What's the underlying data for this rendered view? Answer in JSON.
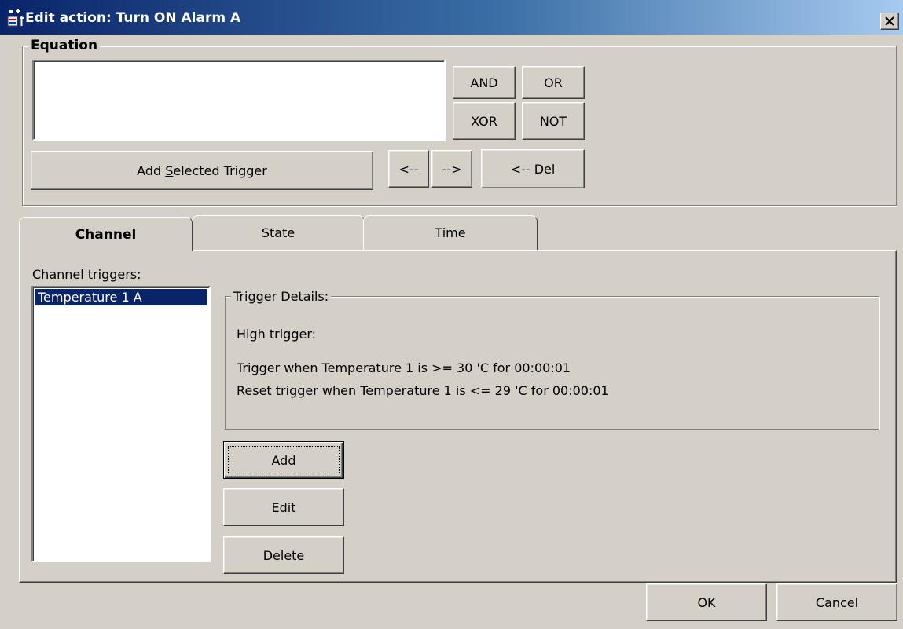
{
  "window": {
    "title": "Edit action: Turn ON Alarm A",
    "icon": "app-icon",
    "close_glyph": "✕"
  },
  "equation": {
    "legend": "Equation",
    "text_value": "",
    "operators": {
      "and": "AND",
      "or": "OR",
      "xor": "XOR",
      "not": "NOT"
    },
    "add_selected_trigger": {
      "before": "Add ",
      "mnemonic": "S",
      "after": "elected Trigger"
    },
    "move_left": "<--",
    "move_right": "-->",
    "delete_left": "<-- Del"
  },
  "tabs": [
    {
      "label": "Channel",
      "active": true
    },
    {
      "label": "State",
      "active": false
    },
    {
      "label": "Time",
      "active": false
    }
  ],
  "channel_panel": {
    "list_label": "Channel triggers:",
    "triggers": [
      "Temperature 1 A"
    ],
    "selected_index": 0,
    "details": {
      "legend": "Trigger Details:",
      "type_line": "High trigger:",
      "trigger_line": "Trigger when Temperature 1 is >=  30 'C for 00:00:01",
      "reset_line": "Reset trigger when Temperature 1 is <=  29 'C for 00:00:01"
    },
    "buttons": {
      "add": "Add",
      "edit": "Edit",
      "delete": "Delete"
    }
  },
  "footer": {
    "ok": "OK",
    "cancel": "Cancel"
  },
  "colors": {
    "face": "#d4d0c8",
    "title_start": "#0a246a",
    "title_end": "#a6caf0",
    "selection": "#0a246a"
  }
}
